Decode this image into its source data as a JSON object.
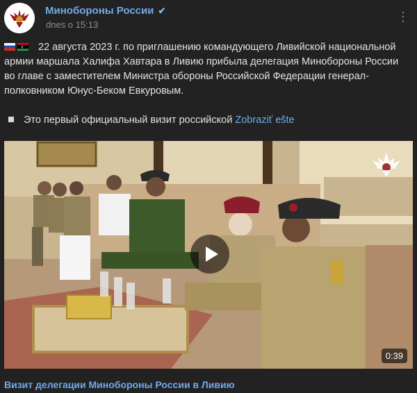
{
  "post": {
    "channel_name": "Минобороны России",
    "verified_icon": "✔",
    "time": "dnes o 15:13",
    "more_icon": "⋮",
    "paragraph1": "22 августа 2023 г. по приглашению командующего Ливийской национальной армии маршала Халифа Хавтара в Ливию прибыла делегация Минобороны России во главе с заместителем Министра обороны Российской Федерации генерал-полковником Юнус-Беком Евкуровым.",
    "paragraph2": "Это первый официальный визит российской",
    "show_more": "Zobraziť ešte"
  },
  "video": {
    "duration": "0:39",
    "title": "Визит делегации Минобороны России в Ливию"
  },
  "colors": {
    "link": "#71aaeb",
    "background": "#222222",
    "text": "#e1e3e6",
    "muted": "#8c9095"
  },
  "icons": [
    "channel-avatar-emblem",
    "verified-icon",
    "more-options-icon",
    "russia-flag-icon",
    "libya-flag-icon",
    "play-icon",
    "mod-watermark-icon"
  ]
}
